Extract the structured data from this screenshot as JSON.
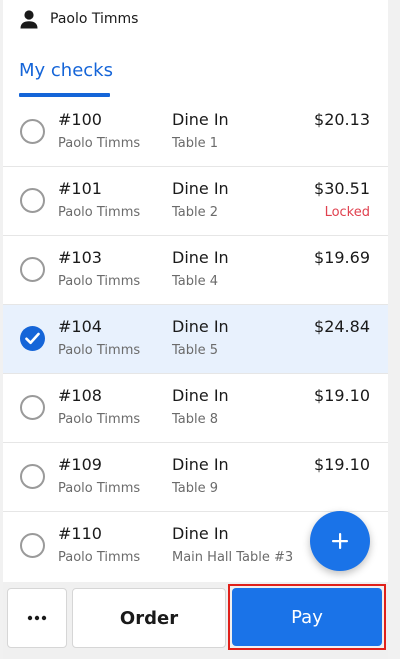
{
  "user": {
    "name": "Paolo Timms",
    "icon": "person-icon"
  },
  "tabs": [
    {
      "label": "My checks",
      "active": true
    }
  ],
  "colors": {
    "accent": "#1565d8",
    "locked": "#e0414f",
    "selected_row": "#e8f1fd",
    "highlight_frame": "#e0201a"
  },
  "checks": [
    {
      "number": "#100",
      "owner": "Paolo Timms",
      "type": "Dine In",
      "table": "Table 1",
      "amount": "$20.13",
      "status": "",
      "selected": false
    },
    {
      "number": "#101",
      "owner": "Paolo Timms",
      "type": "Dine In",
      "table": "Table 2",
      "amount": "$30.51",
      "status": "Locked",
      "selected": false
    },
    {
      "number": "#103",
      "owner": "Paolo Timms",
      "type": "Dine In",
      "table": "Table 4",
      "amount": "$19.69",
      "status": "",
      "selected": false
    },
    {
      "number": "#104",
      "owner": "Paolo Timms",
      "type": "Dine In",
      "table": "Table 5",
      "amount": "$24.84",
      "status": "",
      "selected": true
    },
    {
      "number": "#108",
      "owner": "Paolo Timms",
      "type": "Dine In",
      "table": "Table 8",
      "amount": "$19.10",
      "status": "",
      "selected": false
    },
    {
      "number": "#109",
      "owner": "Paolo Timms",
      "type": "Dine In",
      "table": "Table 9",
      "amount": "$19.10",
      "status": "",
      "selected": false
    },
    {
      "number": "#110",
      "owner": "Paolo Timms",
      "type": "Dine In",
      "table": "Main Hall Table #3",
      "amount": "",
      "status": "",
      "selected": false
    }
  ],
  "fab": {
    "icon": "plus-icon"
  },
  "toolbar": {
    "more_icon": "more-horizontal-icon",
    "order_label": "Order",
    "pay_label": "Pay"
  }
}
